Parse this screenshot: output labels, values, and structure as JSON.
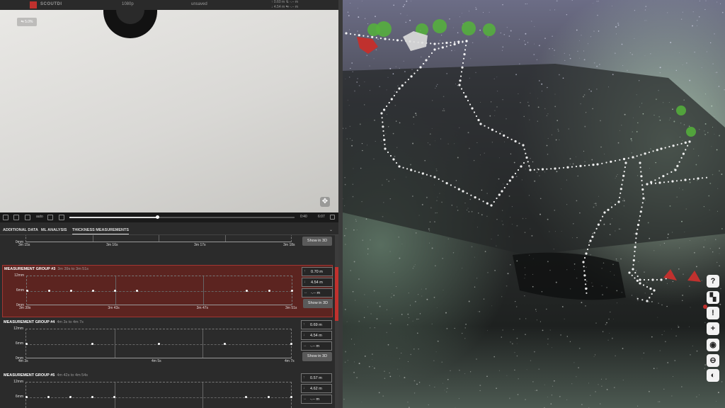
{
  "app": {
    "brand": "SCOUTDI",
    "resolution": "1080p",
    "status": "unsaved",
    "dist_top": "0.60 m",
    "dist_bottom": "4.54 m",
    "dist_extra": "-.-- m"
  },
  "video": {
    "badge": "⇆ 5.0%",
    "expand_icon": "✥"
  },
  "controls": {
    "speed": "auto",
    "time_current": "0:40",
    "time_total": "6:07",
    "progress": 0.39
  },
  "tabs": [
    {
      "label": "ADDITIONAL DATA",
      "active": false
    },
    {
      "label": "ML ANALYSIS",
      "active": false
    },
    {
      "label": "THICKNESS MEASUREMENTS",
      "active": true
    }
  ],
  "groups": [
    {
      "title": "",
      "range": "",
      "y_ticks": [
        "0mm"
      ],
      "x_ticks": [
        "3m 15s",
        "3m 16s",
        "3m 17s",
        "3m 18s",
        "3m 18s"
      ],
      "points": [
        [
          0.0,
          0.5
        ],
        [
          0.33,
          0.5
        ],
        [
          0.66,
          0.5
        ]
      ],
      "stats": [
        "-.-- m"
      ],
      "button": "Show in 3D"
    },
    {
      "title": "MEASUREMENT GROUP #3",
      "range": "3m 39s to 3m 51s",
      "y_ticks": [
        "12mm",
        "6mm",
        "0mm"
      ],
      "x_ticks": [
        "3m 39s",
        "3m 43s",
        "3m 47s",
        "3m 51s"
      ],
      "points": [
        [
          0.0,
          0.5
        ],
        [
          0.085,
          0.5
        ],
        [
          0.167,
          0.5
        ],
        [
          0.25,
          0.5
        ],
        [
          0.333,
          0.5
        ],
        [
          0.416,
          0.5
        ],
        [
          0.83,
          0.5
        ],
        [
          0.915,
          0.5
        ],
        [
          1.0,
          0.5
        ]
      ],
      "stats": [
        "0.70 m",
        "4.54 m",
        "-.-- m"
      ],
      "button": "Show in 3D"
    },
    {
      "title": "MEASUREMENT GROUP #4",
      "range": "4m 3s to 4m 7s",
      "y_ticks": [
        "12mm",
        "6mm",
        "0mm"
      ],
      "x_ticks": [
        "4m 3s",
        "4m 5s",
        "4m 7s"
      ],
      "points": [
        [
          0.0,
          0.5
        ],
        [
          0.25,
          0.5
        ],
        [
          0.5,
          0.5
        ],
        [
          0.75,
          0.5
        ],
        [
          1.0,
          0.5
        ]
      ],
      "stats": [
        "0.69 m",
        "4.54 m",
        "-.-- m"
      ],
      "button": "Show in 3D"
    },
    {
      "title": "MEASUREMENT GROUP #5",
      "range": "4m 42s to 4m 54s",
      "y_ticks": [
        "12mm",
        "6mm"
      ],
      "x_ticks": [],
      "points": [
        [
          0.0,
          0.5
        ],
        [
          0.085,
          0.5
        ],
        [
          0.167,
          0.5
        ],
        [
          0.25,
          0.5
        ],
        [
          0.333,
          0.5
        ],
        [
          0.83,
          0.5
        ],
        [
          0.915,
          0.5
        ],
        [
          1.0,
          0.5
        ]
      ],
      "stats": [
        "0.57 m",
        "4.62 m",
        "-.-- m"
      ],
      "button": ""
    }
  ],
  "toolbar": [
    {
      "icon": "help-icon",
      "glyph": "?"
    },
    {
      "icon": "map-icon",
      "glyph": "▚"
    },
    {
      "icon": "alert-icon",
      "glyph": "!"
    },
    {
      "icon": "add-icon",
      "glyph": "+"
    },
    {
      "icon": "eye-icon",
      "glyph": "◉"
    },
    {
      "icon": "minus-icon",
      "glyph": "⊖"
    },
    {
      "icon": "contrast-icon",
      "glyph": "◐"
    }
  ],
  "colors": {
    "accent": "#c0312e",
    "highlight_bg": "#5c2420",
    "path": "#ffffff",
    "marker_green": "#55b33b",
    "marker_red": "#c0312e"
  }
}
